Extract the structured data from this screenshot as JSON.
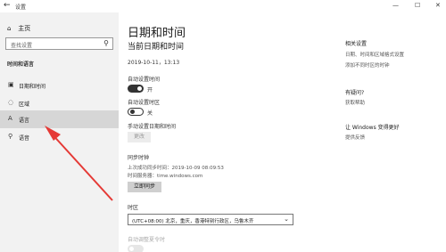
{
  "window": {
    "back_glyph": "←",
    "title": "设置",
    "controls": [
      "—",
      "☐",
      "✕"
    ]
  },
  "sidebar": {
    "home_label": "主页",
    "search_placeholder": "查找设置",
    "section_title": "时间和语言",
    "items": [
      {
        "label": "日期和时间",
        "icon": "calendar-clock-icon",
        "glyph": "▣"
      },
      {
        "label": "区域",
        "icon": "globe-icon",
        "glyph": "◌"
      },
      {
        "label": "语言",
        "icon": "language-icon",
        "glyph": "A"
      },
      {
        "label": "语音",
        "icon": "microphone-icon",
        "glyph": "⚲"
      }
    ],
    "active_index": 2
  },
  "main": {
    "title": "日期和时间",
    "current_heading": "当前日期和时间",
    "current_datetime": "2019-10-11，13:13",
    "auto_time_label": "自动设置时间",
    "auto_time_state": "开",
    "auto_zone_label": "自动设置时区",
    "auto_zone_state": "关",
    "manual_label": "手动设置日期和时间",
    "change_button": "更改",
    "sync_heading": "同步时钟",
    "last_sync": "上次成功同步时间：2019-10-09 08:09:53",
    "time_server": "时间服务器：time.windows.com",
    "sync_button": "立即同步",
    "zone_label": "时区",
    "zone_value": "(UTC+08:00) 北京，重庆，香港特别行政区，乌鲁木齐",
    "dst_label": "自动调整夏令时"
  },
  "related": {
    "heading": "相关设置",
    "links": [
      "日期、时间和区域格式设置",
      "添加不同时区的时钟"
    ],
    "help_heading": "有疑问?",
    "help_link": "获取帮助",
    "improve_heading": "让 Windows 变得更好",
    "improve_link": "提供反馈"
  },
  "colors": {
    "sidebar_bg": "#f2f2f2",
    "active_bg": "#d6d6d6",
    "arrow": "#e53935"
  }
}
